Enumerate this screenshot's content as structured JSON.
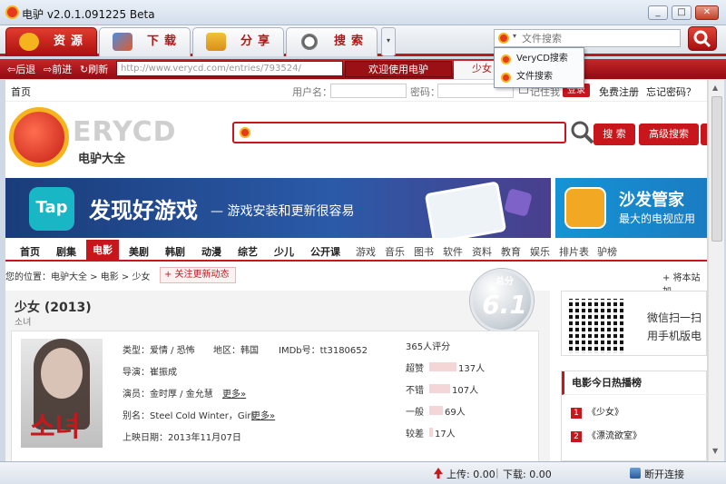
{
  "window": {
    "title": "电驴 v2.0.1.091225 Beta",
    "min": "0",
    "max": "1",
    "close": "r"
  },
  "tabs": [
    {
      "label": "资源"
    },
    {
      "label": "下载"
    },
    {
      "label": "分享"
    },
    {
      "label": "搜索"
    }
  ],
  "search": {
    "placeholder": "文件搜索",
    "dropdown": [
      "VeryCD搜索",
      "文件搜索"
    ]
  },
  "nav": {
    "back": "后退",
    "forward": "前进",
    "refresh": "刷新",
    "url": "http://www.verycd.com/entries/793524/",
    "tab1": "欢迎使用电驴",
    "tab2": "少女"
  },
  "page": {
    "home": "首页",
    "username_label": "用户名：",
    "password_label": "密码：",
    "remember": "记住我",
    "login": "登录",
    "register": "免费注册",
    "forgot": "忘记密码？",
    "brand": "ERYCD",
    "brand_sub": "电驴大全",
    "search_btn": "搜 索",
    "adv_search_btn": "高级搜索",
    "banner1_icon": "Tap",
    "banner1_title": "发现好游戏",
    "banner1_sub": "— 游戏安装和更新很容易",
    "banner2_title": "沙发管家",
    "banner2_sub": "最大的电视应用",
    "categories": [
      "首页",
      "剧集",
      "电影",
      "美剧",
      "韩剧",
      "动漫",
      "综艺",
      "少儿",
      "公开课",
      "游戏",
      "音乐",
      "图书",
      "软件",
      "资料",
      "教育",
      "娱乐",
      "排片表",
      "驴榜"
    ],
    "breadcrumb": "您的位置：电驴大全 > 电影 > 少女",
    "follow": "+ 关注更新动态",
    "add_to": "+ 将本站加",
    "movie": {
      "title": "少女 (2013)",
      "subtitle": "소녀",
      "score_label": "总分",
      "score": "6.1",
      "type": "类型：爱情 / 恐怖",
      "region": "地区：韩国",
      "imdb": "IMDb号：tt3180652",
      "director": "导演：崔振成",
      "actors": "演员：金时厚 / 金允慧",
      "more1": "更多»",
      "aka": "别名：Steel Cold Winter，Girl",
      "more2": "更多»",
      "release": "上映日期：2013年11月07日",
      "rating_count": "365人评分",
      "ratings": [
        {
          "label": "超赞",
          "count": "137人",
          "value": 137
        },
        {
          "label": "不错",
          "count": "107人",
          "value": 107
        },
        {
          "label": "一般",
          "count": "69人",
          "value": 69
        },
        {
          "label": "较差",
          "count": "17人",
          "value": 17
        }
      ],
      "poster_text": "소녀"
    },
    "qr_line1": "微信扫一扫",
    "qr_line2": "用手机版电",
    "hot_title": "电影今日热播榜",
    "hot": [
      {
        "rank": "1",
        "title": "《少女》"
      },
      {
        "rank": "2",
        "title": "《漂流欲室》"
      }
    ]
  },
  "status": {
    "upload": "上传: 0.00",
    "download": "下载: 0.00",
    "disconnect": "断开连接"
  }
}
